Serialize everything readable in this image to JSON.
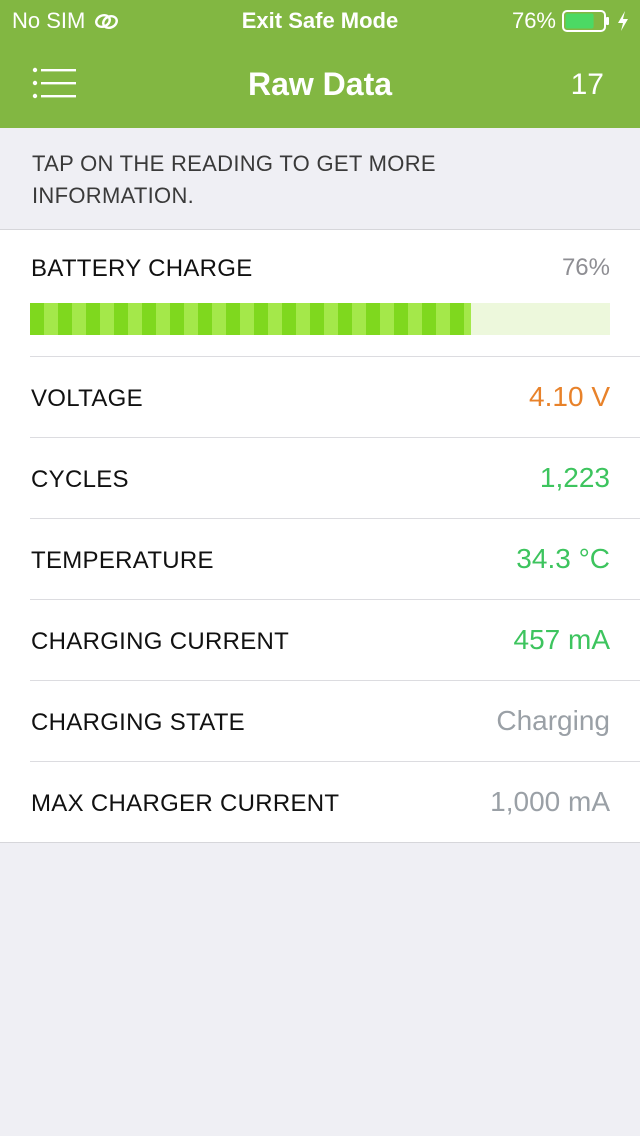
{
  "status_bar": {
    "carrier": "No SIM",
    "center_text": "Exit Safe Mode",
    "battery_percent": "76%",
    "battery_level": 0.76,
    "icons": [
      "link-icon",
      "battery-icon",
      "charging-bolt-icon"
    ]
  },
  "nav": {
    "title": "Raw Data",
    "count": "17",
    "menu_icon": "menu-list-icon"
  },
  "hint": "TAP ON THE READING TO GET MORE INFORMATION.",
  "readings": {
    "battery_charge": {
      "label": "BATTERY CHARGE",
      "value": "76%",
      "level": 0.76
    },
    "voltage": {
      "label": "VOLTAGE",
      "value": "4.10 V"
    },
    "cycles": {
      "label": "CYCLES",
      "value": "1,223"
    },
    "temperature": {
      "label": "TEMPERATURE",
      "value": "34.3 °C"
    },
    "charging_current": {
      "label": "CHARGING CURRENT",
      "value": "457 mA"
    },
    "charging_state": {
      "label": "CHARGING STATE",
      "value": "Charging"
    },
    "max_charger_current": {
      "label": "MAX CHARGER CURRENT",
      "value": "1,000 mA"
    }
  },
  "colors": {
    "header_green": "#82b742",
    "value_orange": "#e8822a",
    "value_green": "#3dc45e",
    "value_gray": "#9aa0a6",
    "charge_fill": "#7fd81e",
    "charge_track": "#edf8dc"
  }
}
